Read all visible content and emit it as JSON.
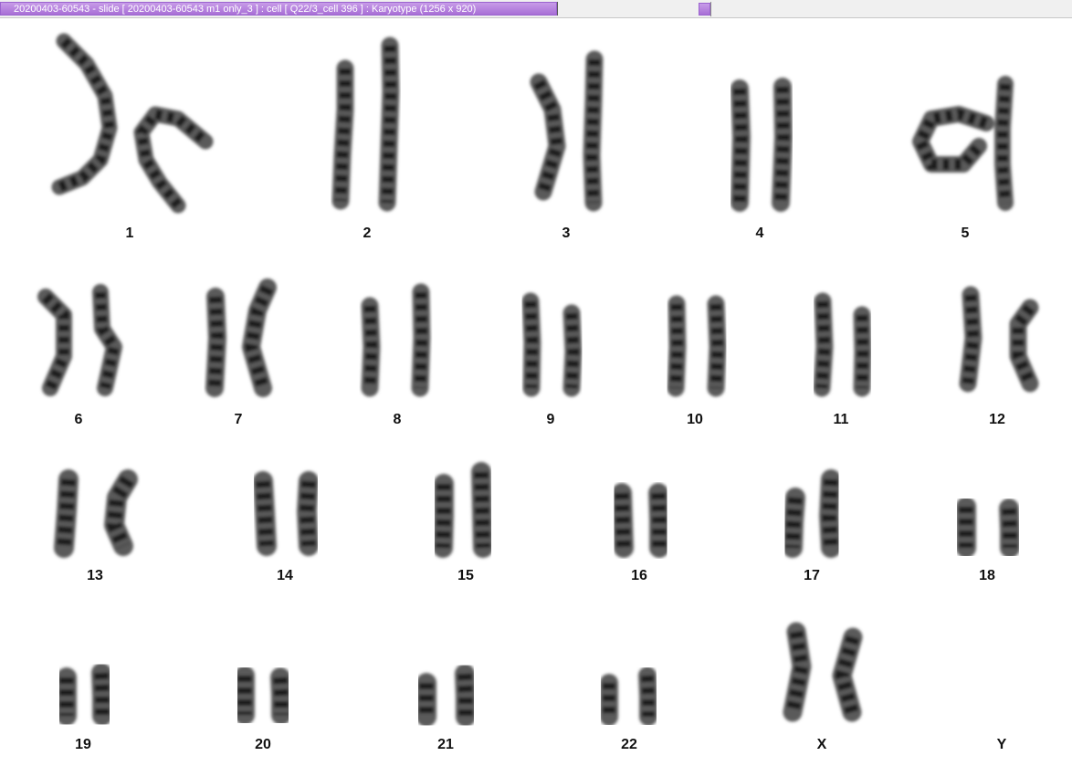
{
  "window": {
    "title": "20200403-60543 - slide [ 20200403-60543 m1 only_3 ] : cell [ Q22/3_cell 396 ] : Karyotype  (1256 x 920)"
  },
  "karyotype": {
    "chromosomes": [
      {
        "label": "1"
      },
      {
        "label": "2"
      },
      {
        "label": "3"
      },
      {
        "label": "4"
      },
      {
        "label": "5"
      },
      {
        "label": "6"
      },
      {
        "label": "7"
      },
      {
        "label": "8"
      },
      {
        "label": "9"
      },
      {
        "label": "10"
      },
      {
        "label": "11"
      },
      {
        "label": "12"
      },
      {
        "label": "13"
      },
      {
        "label": "14"
      },
      {
        "label": "15"
      },
      {
        "label": "16"
      },
      {
        "label": "17"
      },
      {
        "label": "18"
      },
      {
        "label": "19"
      },
      {
        "label": "20"
      },
      {
        "label": "21"
      },
      {
        "label": "22"
      },
      {
        "label": "X"
      },
      {
        "label": "Y"
      }
    ]
  }
}
